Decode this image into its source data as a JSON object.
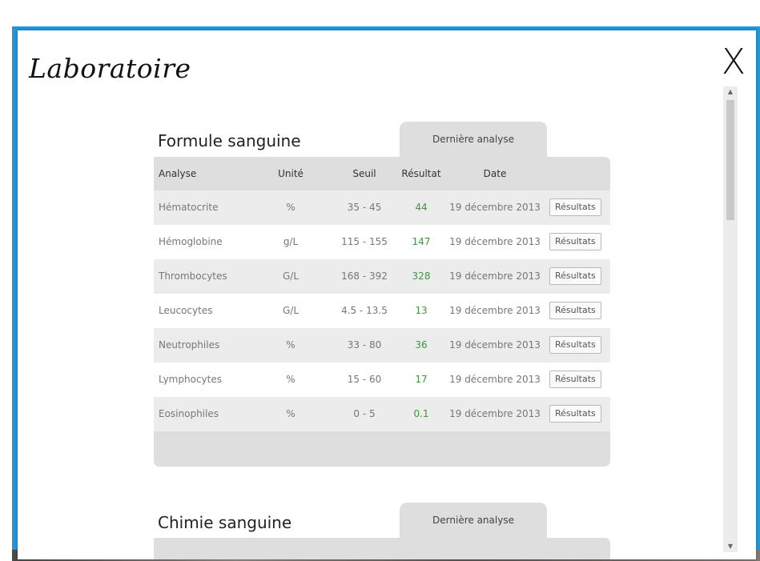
{
  "window": {
    "title": "Laboratoire",
    "close_glyph": "X"
  },
  "sections": [
    {
      "title": "Formule sanguine",
      "tab_label": "Dernière analyse",
      "columns": [
        "Analyse",
        "Unité",
        "Seuil",
        "Résultat",
        "Date"
      ],
      "rows": [
        {
          "name": "Hématocrite",
          "unit": "%",
          "threshold": "35 - 45",
          "result": "44",
          "date": "19 décembre 2013",
          "button": "Résultats"
        },
        {
          "name": "Hémoglobine",
          "unit": "g/L",
          "threshold": "115 - 155",
          "result": "147",
          "date": "19 décembre 2013",
          "button": "Résultats"
        },
        {
          "name": "Thrombocytes",
          "unit": "G/L",
          "threshold": "168 - 392",
          "result": "328",
          "date": "19 décembre 2013",
          "button": "Résultats"
        },
        {
          "name": "Leucocytes",
          "unit": "G/L",
          "threshold": "4.5 - 13.5",
          "result": "13",
          "date": "19 décembre 2013",
          "button": "Résultats"
        },
        {
          "name": "Neutrophiles",
          "unit": "%",
          "threshold": "33 - 80",
          "result": "36",
          "date": "19 décembre 2013",
          "button": "Résultats"
        },
        {
          "name": "Lymphocytes",
          "unit": "%",
          "threshold": "15 - 60",
          "result": "17",
          "date": "19 décembre 2013",
          "button": "Résultats"
        },
        {
          "name": "Eosinophiles",
          "unit": "%",
          "threshold": "0 - 5",
          "result": "0.1",
          "date": "19 décembre 2013",
          "button": "Résultats"
        }
      ]
    },
    {
      "title": "Chimie sanguine",
      "tab_label": "Dernière analyse"
    }
  ],
  "colors": {
    "frame": "#1e98d8",
    "result_green": "#3a9a3a",
    "table_gray": "#dedede"
  },
  "icons": {
    "close": "close-icon",
    "scroll_up": "arrow-up-icon",
    "scroll_down": "arrow-down-icon"
  }
}
